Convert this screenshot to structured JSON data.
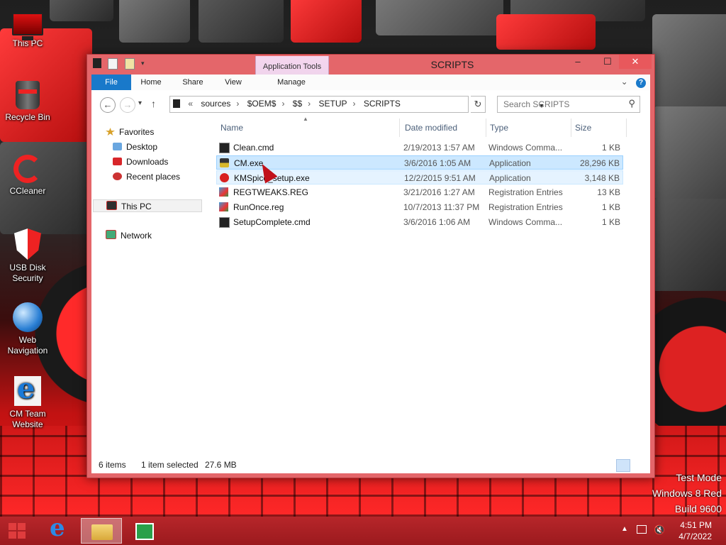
{
  "desktop": {
    "icons": [
      {
        "label": "This PC",
        "icon": "this-pc-icon"
      },
      {
        "label": "Recycle Bin",
        "icon": "recycle-bin-icon"
      },
      {
        "label": "CCleaner",
        "icon": "ccleaner-icon"
      },
      {
        "label": "USB Disk Security",
        "icon": "usb-disk-security-icon"
      },
      {
        "label": "Web Navigation",
        "icon": "web-navigation-icon"
      },
      {
        "label": "CM Team Website",
        "icon": "internet-explorer-icon"
      }
    ],
    "watermark": {
      "line1": "Test Mode",
      "line2": "Windows 8 Red",
      "line3": "Build 9600"
    }
  },
  "window": {
    "title": "SCRIPTS",
    "contextual_group": "Application Tools",
    "ribbon_tabs": {
      "file": "File",
      "home": "Home",
      "share": "Share",
      "view": "View",
      "manage": "Manage"
    },
    "controls": {
      "minimize": "–",
      "maximize": "☐",
      "close": "✕"
    },
    "ribbon_expand": "⌄",
    "help": "?"
  },
  "address": {
    "overflow": "«",
    "crumbs": [
      "sources",
      "$OEM$",
      "$$",
      "SETUP",
      "SCRIPTS"
    ],
    "search_placeholder": "Search SCRIPTS"
  },
  "nav": {
    "back": "←",
    "forward": "→",
    "recent": "▾",
    "up": "↑",
    "refresh": "↻",
    "pane": {
      "favorites": "Favorites",
      "desktop": "Desktop",
      "downloads": "Downloads",
      "recent_places": "Recent places",
      "this_pc": "This PC",
      "network": "Network"
    }
  },
  "columns": {
    "name": "Name",
    "date": "Date modified",
    "type": "Type",
    "size": "Size"
  },
  "files": [
    {
      "name": "Clean.cmd",
      "date": "2/19/2013 1:57 AM",
      "type": "Windows Comma...",
      "size": "1 KB",
      "icon": "cmd-file-icon"
    },
    {
      "name": "CM.exe",
      "date": "3/6/2016 1:05 AM",
      "type": "Application",
      "size": "28,296 KB",
      "icon": "cm-exe-icon"
    },
    {
      "name": "KMSpico_setup.exe",
      "date": "12/2/2015 9:51 AM",
      "type": "Application",
      "size": "3,148 KB",
      "icon": "kmspico-icon"
    },
    {
      "name": "REGTWEAKS.REG",
      "date": "3/21/2016 1:27 AM",
      "type": "Registration Entries",
      "size": "13 KB",
      "icon": "reg-file-icon"
    },
    {
      "name": "RunOnce.reg",
      "date": "10/7/2013 11:37 PM",
      "type": "Registration Entries",
      "size": "1 KB",
      "icon": "reg-file-icon"
    },
    {
      "name": "SetupComplete.cmd",
      "date": "3/6/2016 1:06 AM",
      "type": "Windows Comma...",
      "size": "1 KB",
      "icon": "cmd-file-icon"
    }
  ],
  "status": {
    "items": "6 items",
    "selected": "1 item selected",
    "size": "27.6 MB"
  },
  "taskbar": {
    "time": "4:51 PM",
    "date": "4/7/2022",
    "tray_overflow": "▲",
    "volume": "🔇"
  }
}
